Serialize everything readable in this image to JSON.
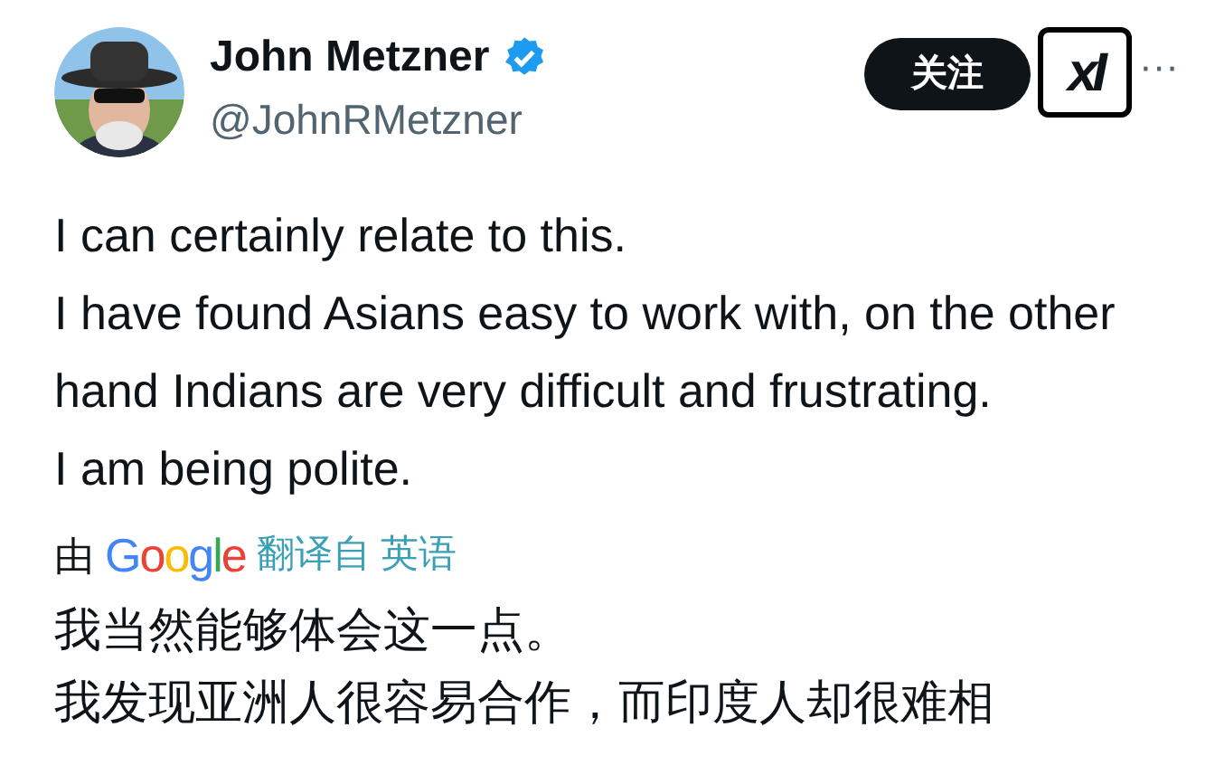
{
  "author": {
    "name": "John Metzner",
    "verified": true,
    "handle": "@JohnRMetzner"
  },
  "follow_button": {
    "label": "关注"
  },
  "badge": {
    "label": "xI"
  },
  "more": {
    "label": "···"
  },
  "tweet_lines": [
    "I can certainly relate to this.",
    "I have found Asians easy to work with, on the other hand Indians are very difficult and frustrating.",
    "I am being polite."
  ],
  "translation": {
    "by": "由",
    "brand": "Google",
    "action": "翻译自 英语"
  },
  "translated_lines": [
    "我当然能够体会这一点。",
    "我发现亚洲人很容易合作，而印度人却很难相"
  ]
}
